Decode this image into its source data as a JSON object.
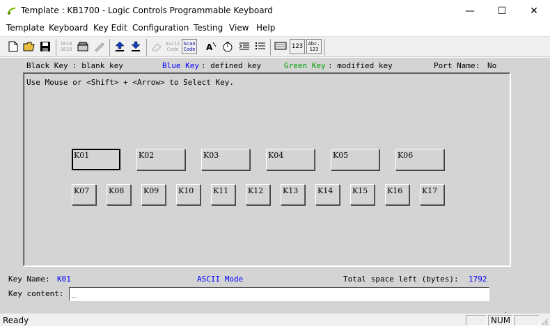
{
  "window": {
    "title": "Template : KB1700 - Logic Controls  Programmable Keyboard",
    "minimize": "—",
    "maximize": "☐",
    "close": "✕"
  },
  "menu": [
    "Template",
    "Keyboard",
    "Key Edit",
    "Configuration",
    "Testing",
    "View",
    "Help"
  ],
  "toolbar": {
    "ascii_code": "Ascii Code",
    "scan_code": "Scan Code",
    "num_123": "123",
    "abc_123": "Abc.\n123"
  },
  "legend": {
    "black_key": "Black Key",
    "black_desc": ": blank key",
    "blue_key": "Blue Key",
    "blue_desc": ": defined key",
    "green_key": "Green Key",
    "green_desc": ": modified key",
    "port_name_label": "Port Name:",
    "port_name_value": "No"
  },
  "instructions": "Use Mouse or <Shift> + <Arrow> to Select Key.",
  "keys_row1": [
    "K01",
    "K02",
    "K03",
    "K04",
    "K05",
    "K06"
  ],
  "keys_row2": [
    "K07",
    "K08",
    "K09",
    "K10",
    "K11",
    "K12",
    "K13",
    "K14",
    "K15",
    "K16",
    "K17"
  ],
  "selected_key": "K01",
  "info": {
    "key_name_label": "Key Name:",
    "key_name_value": "K01",
    "mode": "ASCII Mode",
    "space_label": "Total space left (bytes):",
    "space_value": "1792"
  },
  "key_content": {
    "label": "Key content:",
    "value": "_"
  },
  "status": {
    "text": "Ready",
    "num": "NUM"
  },
  "colors": {
    "blue": "#0000ff",
    "green": "#00a000",
    "panel": "#d4d4d4"
  }
}
